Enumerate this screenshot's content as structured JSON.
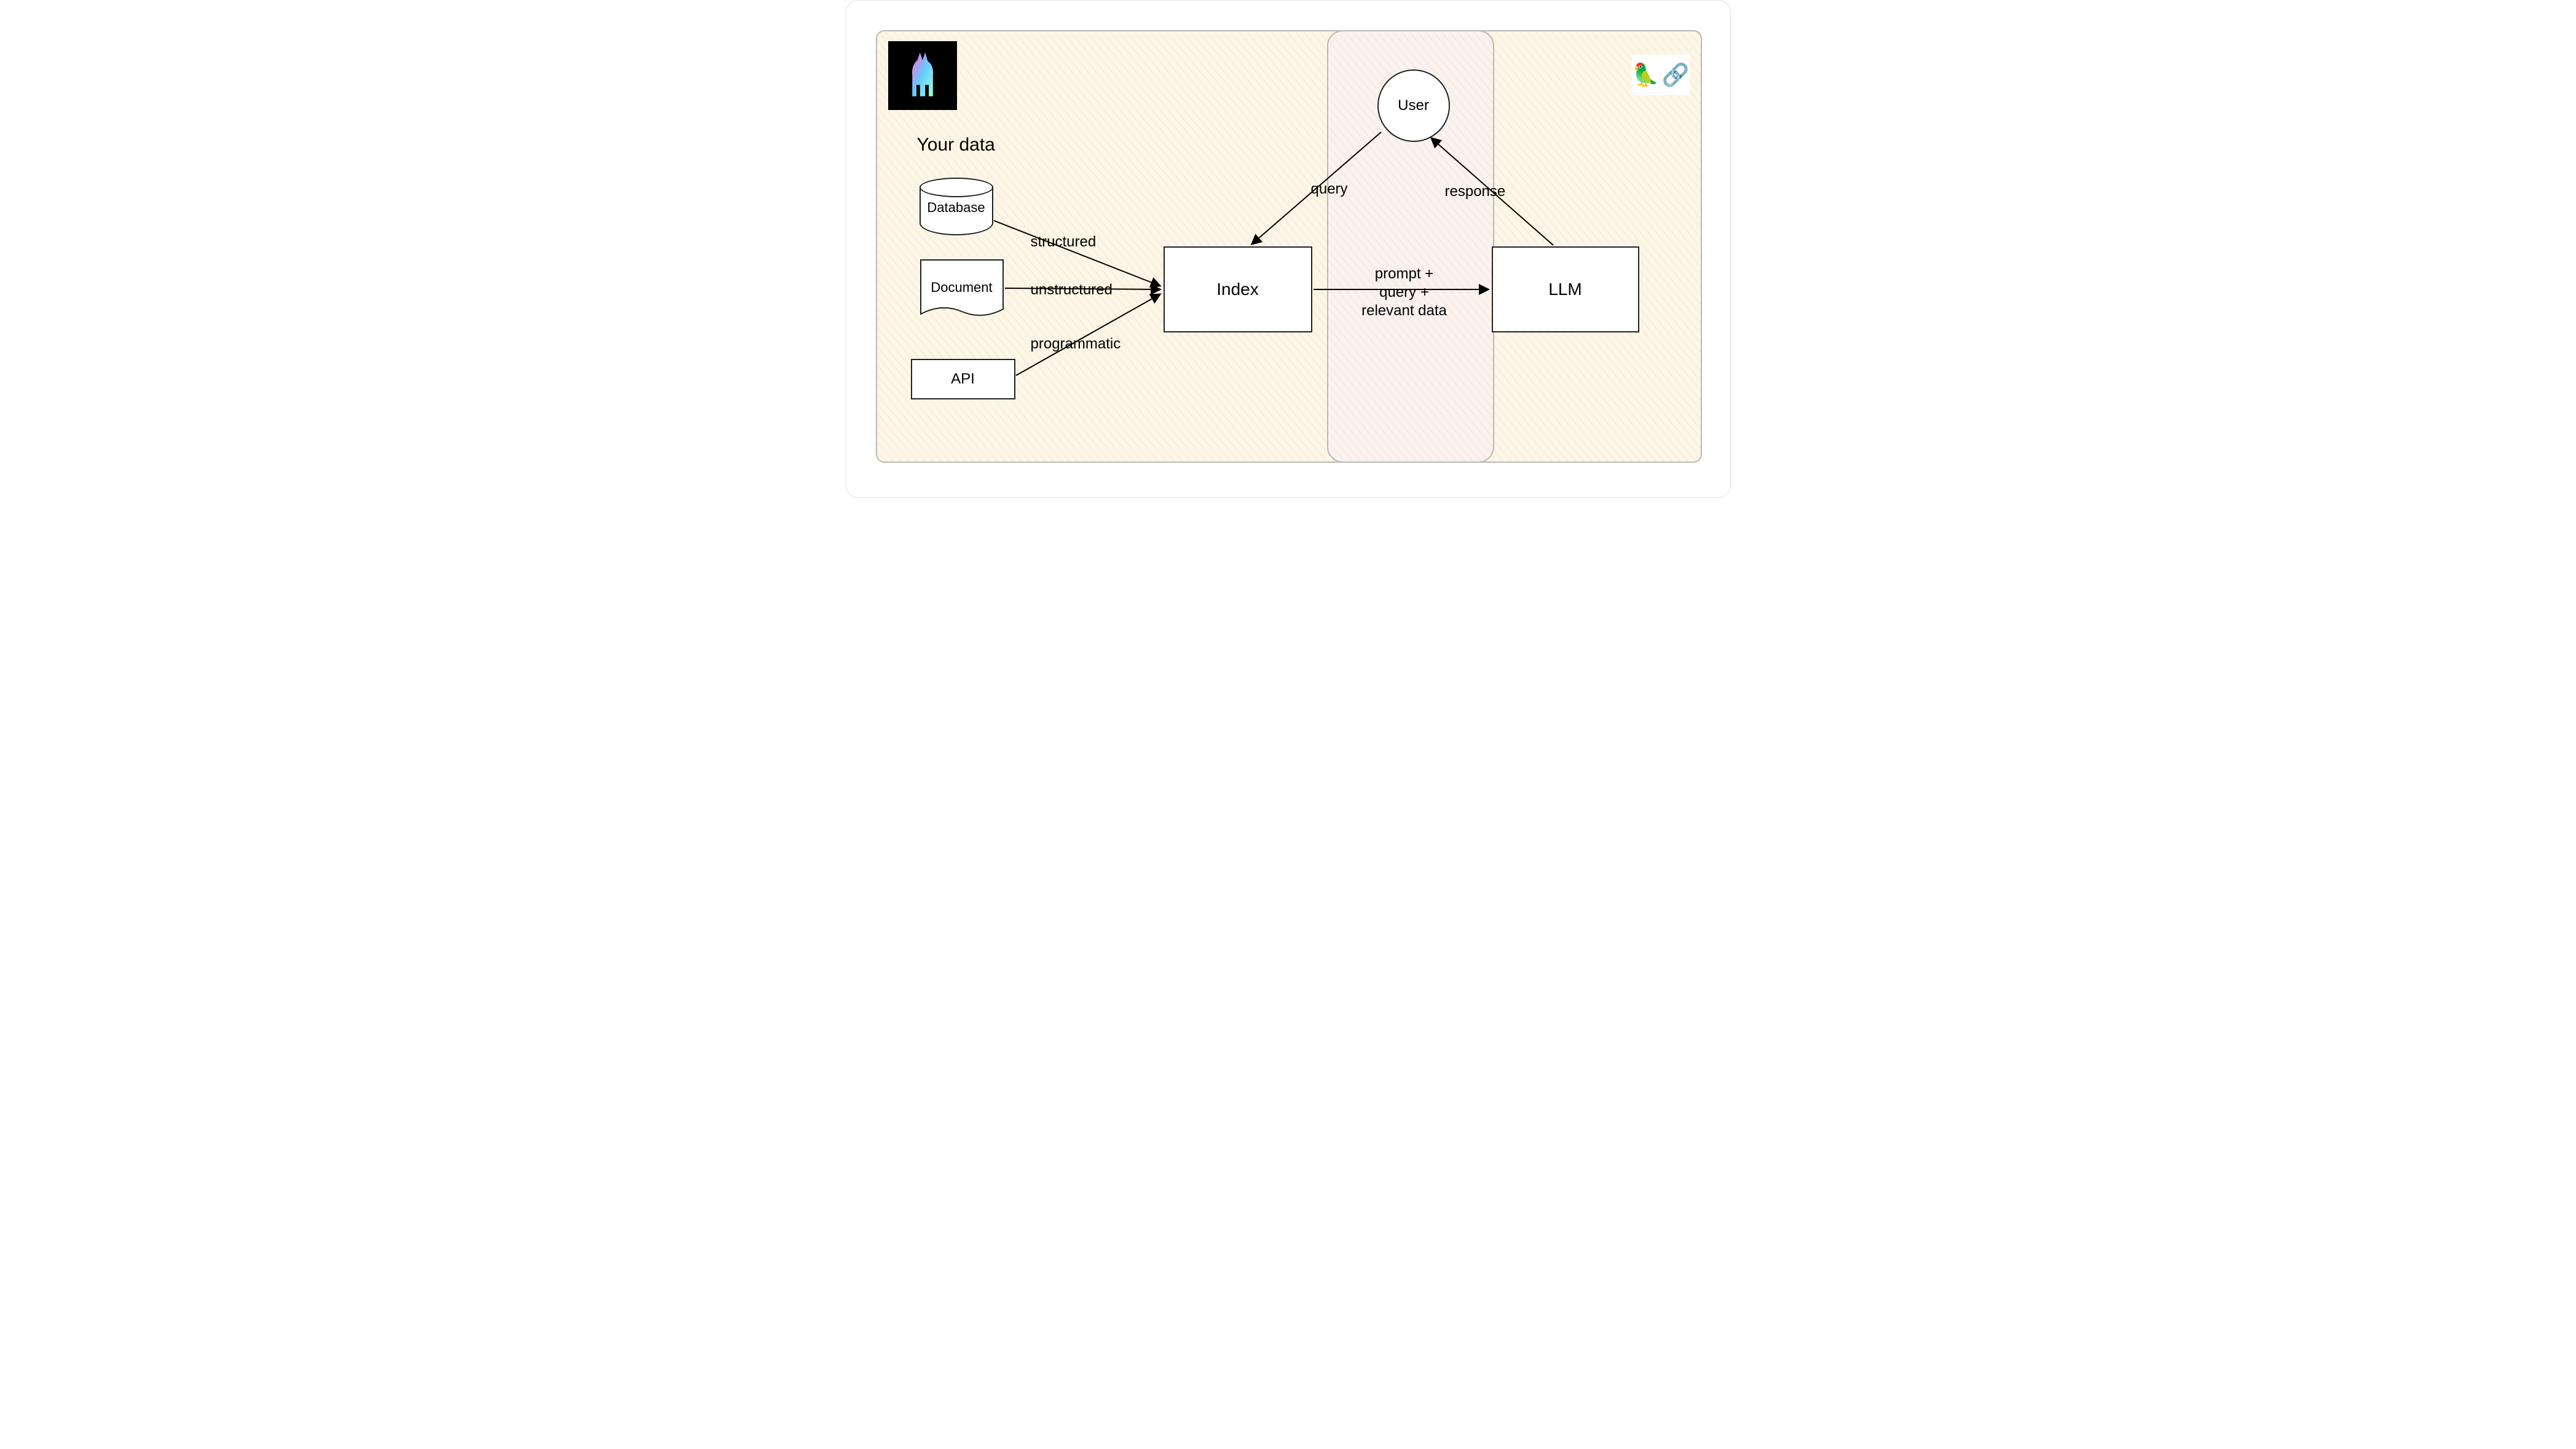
{
  "title": "Your data",
  "nodes": {
    "database": "Database",
    "document": "Document",
    "api": "API",
    "index": "Index",
    "user": "User",
    "llm": "LLM"
  },
  "edges": {
    "structured": "structured",
    "unstructured": "unstructured",
    "programmatic": "programmatic",
    "query": "query",
    "response": "response",
    "prompt": "prompt +\nquery +\nrelevant data"
  },
  "icons": {
    "llama": "llama-logo",
    "parrot": "🦜",
    "chain": "🔗"
  }
}
